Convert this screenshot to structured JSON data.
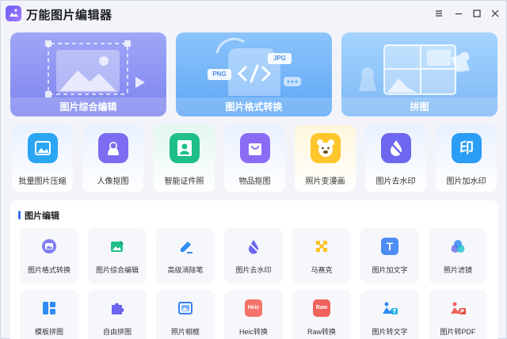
{
  "app": {
    "title": "万能图片编辑器"
  },
  "hero_cards": [
    {
      "label": "图片综合编辑"
    },
    {
      "label": "图片格式转换",
      "badges": [
        "PNG",
        "JPG"
      ]
    },
    {
      "label": "拼图"
    }
  ],
  "quick_tools": [
    {
      "label": "批量图片压缩"
    },
    {
      "label": "人像抠图"
    },
    {
      "label": "智能证件照"
    },
    {
      "label": "物品抠图"
    },
    {
      "label": "照片变漫画"
    },
    {
      "label": "图片去水印"
    },
    {
      "label": "图片加水印",
      "icon_glyph": "印"
    }
  ],
  "editing_section": {
    "title": "图片编辑",
    "tools": [
      {
        "label": "图片格式转换"
      },
      {
        "label": "图片综合编辑"
      },
      {
        "label": "高级消除笔"
      },
      {
        "label": "图片去水印"
      },
      {
        "label": "马赛克"
      },
      {
        "label": "图片加文字",
        "icon_glyph": "T"
      },
      {
        "label": "照片滤镜"
      },
      {
        "label": "模板拼图"
      },
      {
        "label": "自由拼图"
      },
      {
        "label": "照片相框"
      },
      {
        "label": "Heic转换",
        "icon_glyph": "Heic"
      },
      {
        "label": "Raw转换",
        "icon_glyph": "Raw"
      },
      {
        "label": "图片转文字"
      },
      {
        "label": "图片转PDF"
      }
    ]
  },
  "colors": {
    "accent": "#3b6ff5",
    "hero1": "#8990f2",
    "hero2": "#6fb0f7",
    "hero3": "#8cc5fb"
  }
}
